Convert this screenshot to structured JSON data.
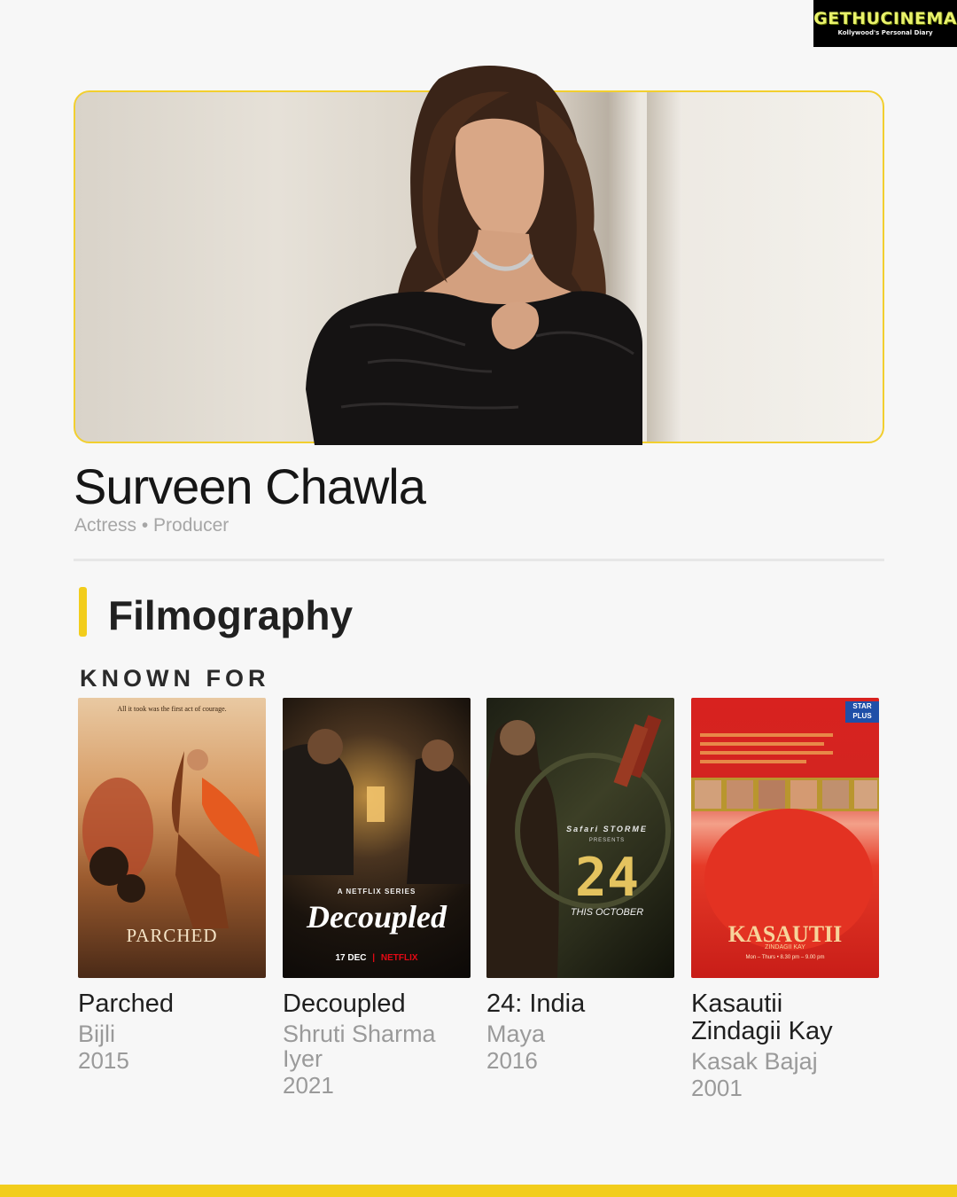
{
  "logo": {
    "main": "GETHUCINEMA",
    "sub": "Kollywood's Personal Diary"
  },
  "person": {
    "name": "Surveen Chawla",
    "roles": "Actress • Producer"
  },
  "section": {
    "title": "Filmography",
    "subtitle": "KNOWN FOR"
  },
  "films": [
    {
      "title": "Parched",
      "role": "Bijli",
      "year": "2015",
      "poster": {
        "tagline": "All it took was the first act of courage.",
        "logo_text": "PARCHED"
      }
    },
    {
      "title": "Decoupled",
      "role": "Shruti Sharma Iyer",
      "year": "2021",
      "poster": {
        "kicker": "A NETFLIX SERIES",
        "logo_text": "Decoupled",
        "date": "17 DEC",
        "network": "NETFLIX"
      }
    },
    {
      "title": "24: India",
      "role": "Maya",
      "year": "2016",
      "poster": {
        "brand": "Safari STORME",
        "presents": "PRESENTS",
        "logo_text": "24",
        "release": "THIS OCTOBER"
      }
    },
    {
      "title": "Kasautii Zindagii Kay",
      "role": "Kasak Bajaj",
      "year": "2001",
      "poster": {
        "channel": "STAR PLUS",
        "logo_text": "KASAUTII",
        "sub_logo": "ZINDAGII KAY",
        "timing": "Mon – Thurs • 8.30 pm – 9.00 pm"
      }
    }
  ],
  "colors": {
    "accent": "#f2cd1c",
    "background": "#f7f7f7",
    "muted_text": "#9a9a9a"
  }
}
